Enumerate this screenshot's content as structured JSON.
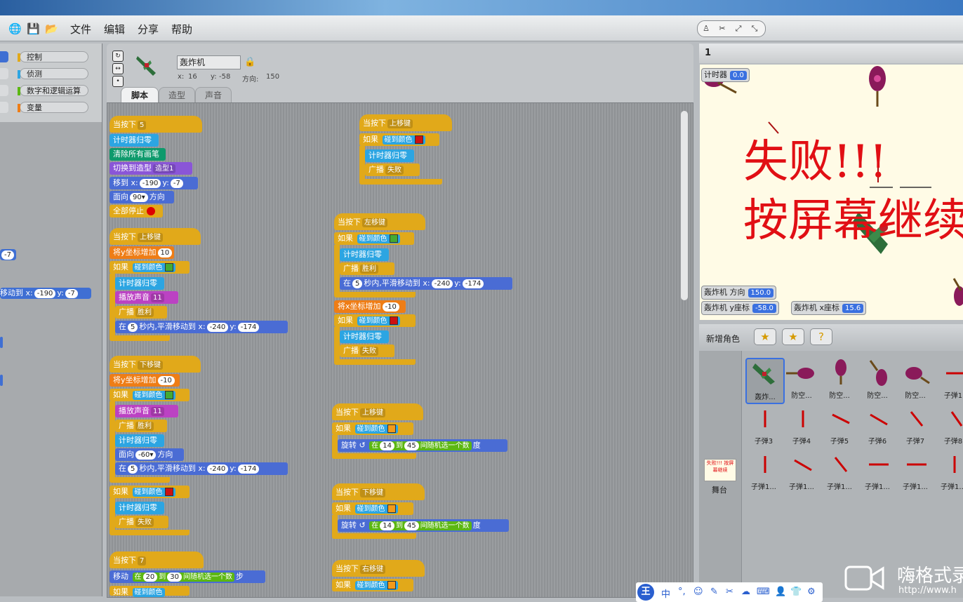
{
  "menu": {
    "items": [
      "文件",
      "编辑",
      "分享",
      "帮助"
    ]
  },
  "categories": [
    {
      "label": "控制",
      "color": "#e1a91a"
    },
    {
      "label": "侦测",
      "color": "#2ca5e2"
    },
    {
      "label": "数字和逻辑运算",
      "color": "#5cb712"
    },
    {
      "label": "变量",
      "color": "#ee7d16"
    }
  ],
  "palette_blocks": {
    "neg7": "-7",
    "move_label": "移动到 x:",
    "move_x": "-190",
    "move_y_label": "y:",
    "move_y": "-7"
  },
  "sprite": {
    "name": "轰炸机",
    "x_label": "x:",
    "x": "16",
    "y_label": "y:",
    "y": "-58",
    "dir_label": "方向:",
    "dir": "150"
  },
  "tabs": [
    "脚本",
    "造型",
    "声音"
  ],
  "scripts": {
    "when_key": "当按下",
    "k5": "5",
    "k7": "7",
    "up": "上移键",
    "down": "下移键",
    "left": "左移键",
    "right": "右移键",
    "timer_reset": "计时器归零",
    "clear": "清除所有画笔",
    "switch_costume": "切换到造型",
    "costume1": "造型1",
    "goto_x": "移到 x:",
    "m190": "-190",
    "y": "y:",
    "m7": "-7",
    "point": "面向",
    "deg90": "90▾",
    "dir_word": "方向",
    "stop_all": "全部停止",
    "change_y_by": "将y坐标增加",
    "v10": "10",
    "vm10": "-10",
    "if": "如果",
    "touch_color": "碰到颜色",
    "play_sound": "播放声音",
    "s11": "11",
    "broadcast": "广播",
    "win": "胜利",
    "fail": "失败",
    "glide_in": "在",
    "secs": "秒内,平滑移动到 x:",
    "m240": "-240",
    "m174": "-174",
    "degm60": "-60▾",
    "change_x_by": "将x坐标增加",
    "turn": "旋转",
    "rand_from": "在",
    "to": "到",
    "rand_tail": "间随机选一个数",
    "deg": "度",
    "r14": "14",
    "r45": "45",
    "move": "移动",
    "r20": "20",
    "r30": "30",
    "steps": "步"
  },
  "stage": {
    "page_num": "1",
    "msg_line1": "失败!!!",
    "msg_line2": "按屏幕继续",
    "monitors": {
      "timer_label": "计时器",
      "timer_val": "0.0",
      "dir_label": "轰炸机 方向",
      "dir_val": "150.0",
      "y_label": "轰炸机 y座标",
      "y_val": "-58.0",
      "x_label": "轰炸机 x座标",
      "x_val": "15.6"
    }
  },
  "sprites_panel": {
    "new_sprite_label": "新增角色",
    "stage_label": "舞台",
    "stage_thumb_text": "失败!!! 按屏幕继续",
    "row1": [
      "轰炸...",
      "防空...",
      "防空...",
      "防空...",
      "防空...",
      "子弹1"
    ],
    "row2": [
      "子弹3",
      "子弹4",
      "子弹5",
      "子弹6",
      "子弹7",
      "子弹8"
    ],
    "row3": [
      "子弹1...",
      "子弹1...",
      "子弹1...",
      "子弹1...",
      "子弹1...",
      "子弹1..."
    ]
  },
  "ime": {
    "logo": "王",
    "items": [
      "中",
      "°,",
      "☺",
      "✎",
      "✂",
      "☁",
      "⌨",
      "👤",
      "👕",
      "⚙"
    ]
  },
  "watermark": {
    "text": "嗨格式录",
    "sub": "http://www.h"
  }
}
